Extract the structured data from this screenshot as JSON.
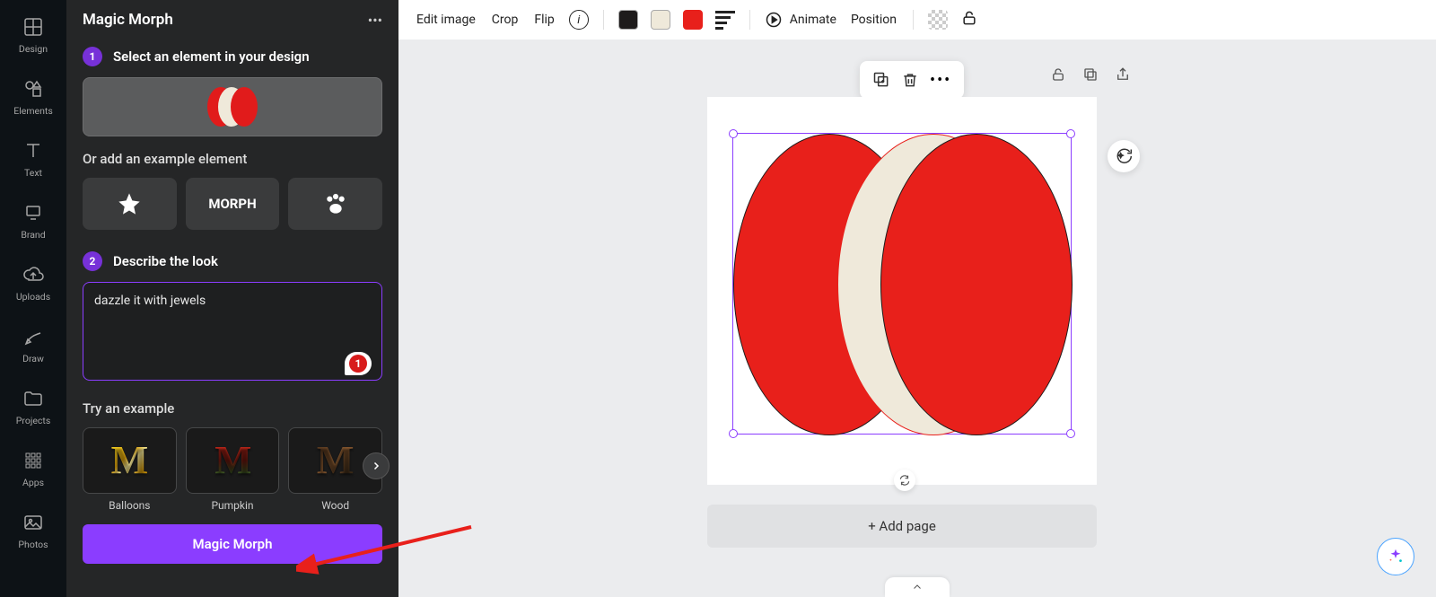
{
  "rail": {
    "items": [
      {
        "label": "Design"
      },
      {
        "label": "Elements"
      },
      {
        "label": "Text"
      },
      {
        "label": "Brand"
      },
      {
        "label": "Uploads"
      },
      {
        "label": "Draw"
      },
      {
        "label": "Projects"
      },
      {
        "label": "Apps"
      },
      {
        "label": "Photos"
      }
    ]
  },
  "panel": {
    "title": "Magic Morph",
    "step1": {
      "num": "1",
      "label": "Select an element in your design"
    },
    "example_sub": "Or add an example element",
    "example_tiles": {
      "morph_text": "MORPH"
    },
    "step2": {
      "num": "2",
      "label": "Describe the look"
    },
    "prompt_value": "dazzle it with jewels",
    "prompt_badge": "1",
    "try_label": "Try an example",
    "try_items": [
      {
        "caption": "Balloons"
      },
      {
        "caption": "Pumpkin"
      },
      {
        "caption": "Wood"
      }
    ],
    "cta": "Magic Morph"
  },
  "toolbar": {
    "edit_image": "Edit image",
    "crop": "Crop",
    "flip": "Flip",
    "animate": "Animate",
    "position": "Position",
    "colors": {
      "dark": "#1e1b1b",
      "cream": "#efe9da",
      "red": "#e8201b"
    }
  },
  "canvas": {
    "addpage": "+ Add page"
  }
}
